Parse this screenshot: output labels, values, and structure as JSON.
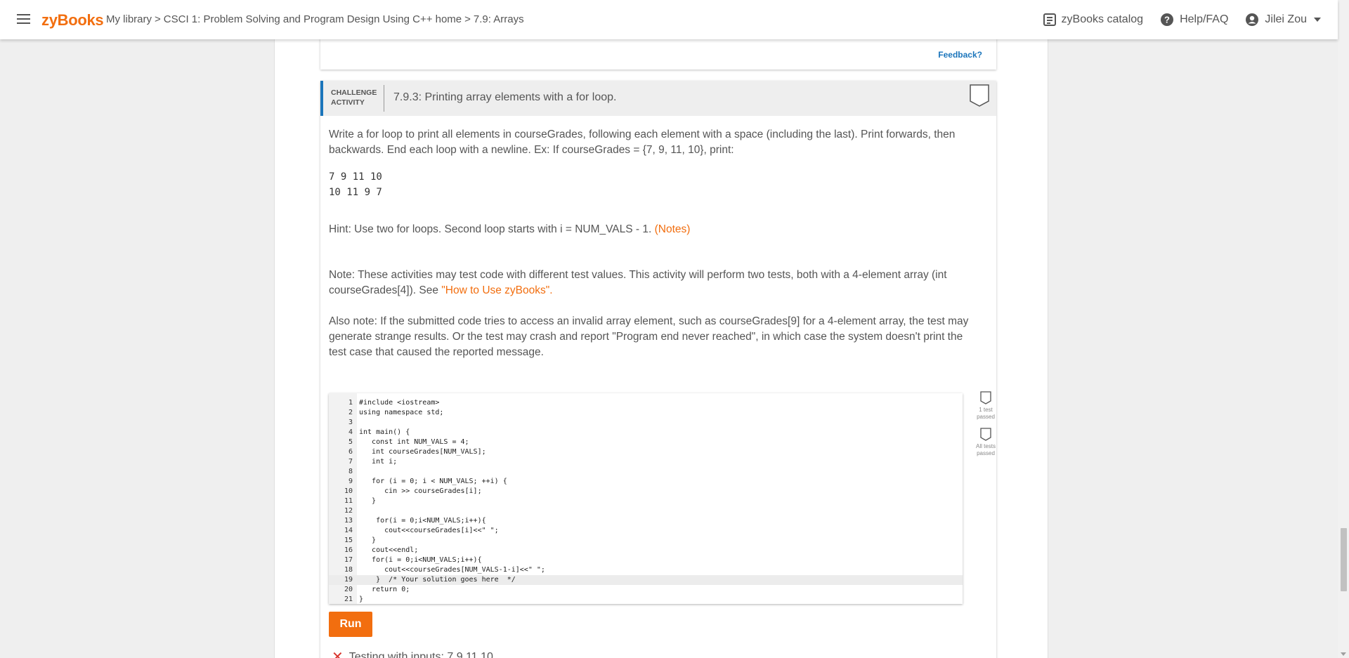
{
  "header": {
    "logo": "zyBooks",
    "breadcrumb": [
      {
        "label": "My library"
      },
      {
        "label": "CSCI 1: Problem Solving and Program Design Using C++ home"
      },
      {
        "label": "7.9: Arrays"
      }
    ],
    "separator": ">",
    "catalog": "zyBooks catalog",
    "help": "Help/FAQ",
    "user": "Jilei Zou"
  },
  "prev_card": {
    "feedback": "Feedback?"
  },
  "activity": {
    "label_line1": "CHALLENGE",
    "label_line2": "ACTIVITY",
    "title": "7.9.3: Printing array elements with a for loop.",
    "instructions": "Write a for loop to print all elements in courseGrades, following each element with a space (including the last). Print forwards, then backwards. End each loop with a newline. Ex: If courseGrades = {7, 9, 11, 10}, print:",
    "example_line1": "7 9 11 10",
    "example_line2": "10 11 9 7",
    "hint": "Hint: Use two for loops. Second loop starts with i = NUM_VALS - 1.",
    "hint_link": "(Notes)",
    "note": "Note: These activities may test code with different test values. This activity will perform two tests, both with a 4-element array (int courseGrades[4]). See",
    "note_link": "\"How to Use zyBooks\"",
    "note_end": ".",
    "also_note": "Also note: If the submitted code tries to access an invalid array element, such as courseGrades[9] for a 4-element array, the test may generate strange results. Or the test may crash and report \"Program end never reached\", in which case the system doesn't print the test case that caused the reported message.",
    "test1_line1": "1 test",
    "test1_line2": "passed",
    "test2_line1": "All tests",
    "test2_line2": "passed",
    "run_label": "Run",
    "testing_text": "Testing with inputs: 7 9 11 10"
  },
  "code": [
    {
      "n": "1",
      "t": "#include <iostream>"
    },
    {
      "n": "2",
      "t": "using namespace std;"
    },
    {
      "n": "3",
      "t": ""
    },
    {
      "n": "4",
      "t": "int main() {"
    },
    {
      "n": "5",
      "t": "   const int NUM_VALS = 4;"
    },
    {
      "n": "6",
      "t": "   int courseGrades[NUM_VALS];"
    },
    {
      "n": "7",
      "t": "   int i;"
    },
    {
      "n": "8",
      "t": ""
    },
    {
      "n": "9",
      "t": "   for (i = 0; i < NUM_VALS; ++i) {"
    },
    {
      "n": "10",
      "t": "      cin >> courseGrades[i];"
    },
    {
      "n": "11",
      "t": "   }"
    },
    {
      "n": "12",
      "t": ""
    },
    {
      "n": "13",
      "t": "    for(i = 0;i<NUM_VALS;i++){"
    },
    {
      "n": "14",
      "t": "      cout<<courseGrades[i]<<\" \";"
    },
    {
      "n": "15",
      "t": "   }"
    },
    {
      "n": "16",
      "t": "   cout<<endl;"
    },
    {
      "n": "17",
      "t": "   for(i = 0;i<NUM_VALS;i++){"
    },
    {
      "n": "18",
      "t": "      cout<<courseGrades[NUM_VALS-1-i]<<\" \";"
    },
    {
      "n": "19",
      "t": "    }  /* Your solution goes here  */"
    },
    {
      "n": "20",
      "t": "   return 0;"
    },
    {
      "n": "21",
      "t": "}"
    }
  ],
  "colors": {
    "brand": "#f26e0f",
    "accent_blue": "#1b75bb",
    "fail_red": "#d9332c"
  },
  "icons": [
    "menu-icon",
    "catalog-icon",
    "help-icon",
    "account-icon",
    "dropdown-caret-icon",
    "progress-shield-icon",
    "test-shield-icon",
    "fail-x-icon"
  ]
}
